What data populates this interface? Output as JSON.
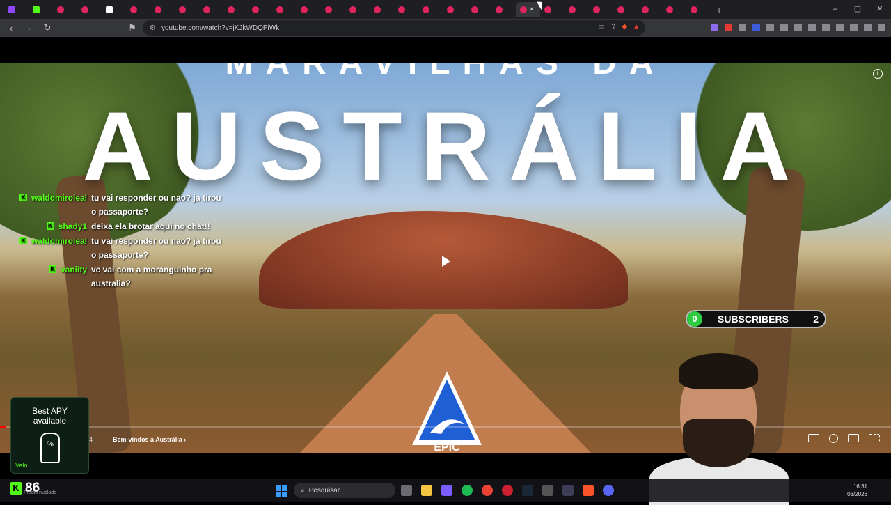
{
  "browser": {
    "url": "youtube.com/watch?v=jKJkWDQPiWk",
    "tab_count_visible": 30,
    "new_tab": "+",
    "window_controls": {
      "minimize": "–",
      "maximize": "▢",
      "close": "✕"
    }
  },
  "video": {
    "title_top": "MARAVILHAS DA",
    "title_main": "AUSTRÁLIA",
    "chapter": "Bem-vindos à Austrália",
    "chapter_arrow": "›",
    "timecode_fragment": "4",
    "progress_fraction": 0.006,
    "info_icon": "i"
  },
  "chat": [
    {
      "user": "waldomiroleal",
      "text": "tu vai responder ou nao? ja tirou o passaporte?"
    },
    {
      "user": "shady1",
      "text": "deixa ela brotar aqui no chat!!"
    },
    {
      "user": "waldomiroleal",
      "text": "tu vai responder ou nao? ja tirou o passaporte?"
    },
    {
      "user": "vaniity",
      "text": "vc vai com a moranguinho pra australia?"
    }
  ],
  "chat_badge": "K",
  "subscribers": {
    "left_count": "0",
    "label": "SUBSCRIBERS",
    "right_count": "2"
  },
  "ad": {
    "line1": "Best APY",
    "line2": "available",
    "trophy": "%",
    "brand": "Valo"
  },
  "kick_counter": {
    "icon": "K",
    "value": "86",
    "sub": "Prédio nublado"
  },
  "taskbar": {
    "search_placeholder": "Pesquisar",
    "time": "16:31",
    "date": "03/2026"
  },
  "colors": {
    "kick_green": "#53fc18",
    "youtube_red": "#ff0000",
    "windows_blue": "#3b9cff"
  }
}
